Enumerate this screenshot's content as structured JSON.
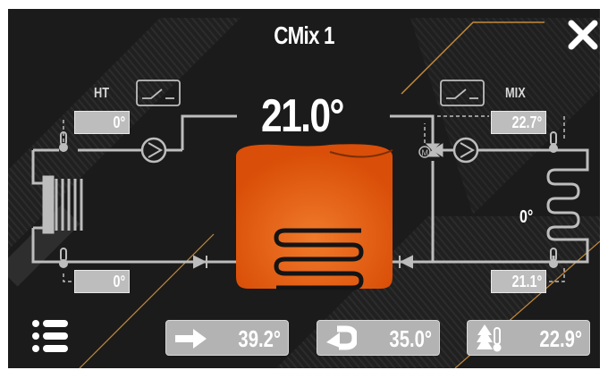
{
  "header": {
    "title": "CMix 1"
  },
  "tank": {
    "temperature": "21.0°"
  },
  "ht": {
    "label": "HT",
    "supply": "0°",
    "return": "0°"
  },
  "mix": {
    "label": "MIX",
    "supply": "22.7°",
    "return": "21.1°",
    "valve_position": "0°"
  },
  "bottom_bar": {
    "supply": "39.2°",
    "return": "35.0°",
    "outdoor": "22.9°"
  },
  "icons": {
    "close": "close-icon",
    "menu": "menu-icon",
    "supply": "arrow-right-icon",
    "return": "return-arrow-icon",
    "outdoor": "tree-thermometer-icon"
  },
  "colors": {
    "tank": "#e8590c",
    "accent": "#c48a3c",
    "pipe": "#bdbdbd"
  }
}
